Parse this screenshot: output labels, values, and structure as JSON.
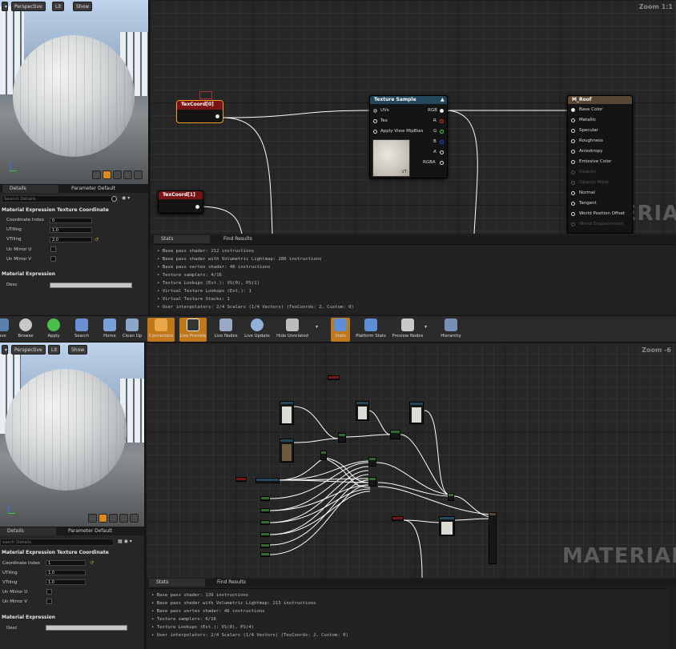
{
  "top": {
    "viewport": {
      "perspective_label": "Perspective",
      "lit_label": "Lit",
      "show_label": "Show"
    },
    "details": {
      "tab_details": "Details",
      "tab_param": "Parameter Default",
      "search_placeholder": "Search Details",
      "section_title": "Material Expression Texture Coordinate",
      "coord_index_label": "Coordinate Index",
      "coord_index_value": "0",
      "utiling_label": "UTiling",
      "utiling_value": "1.0",
      "vtiling_label": "VTiling",
      "vtiling_value": "2.0",
      "unmirror_u_label": "Un Mirror U",
      "unmirror_v_label": "Un Mirror V",
      "section2_title": "Material Expression",
      "desc_label": "Desc"
    },
    "graph": {
      "zoom": "Zoom 1:1",
      "watermark": "MATERIAL",
      "texcoord0": "TexCoord[0]",
      "texcoord1": "TexCoord[1]",
      "texture_sample": {
        "title": "Texture Sample",
        "pins_in": [
          "UVs",
          "Tex",
          "Apply View MipBias"
        ],
        "pins_out": [
          "RGB",
          "R",
          "G",
          "B",
          "A",
          "RGBA"
        ],
        "thumb_label": "VT"
      },
      "m_roof": {
        "title": "M_Roof",
        "pins": [
          "Base Color",
          "Metallic",
          "Specular",
          "Roughness",
          "Anisotropy",
          "Emissive Color",
          "Opacity",
          "Opacity Mask",
          "Normal",
          "Tangent",
          "World Position Offset",
          "World Displacement"
        ]
      }
    },
    "stats": {
      "tab_stats": "Stats",
      "tab_find": "Find Results",
      "lines": [
        "• Base pass shader: 212 instructions",
        "• Base pass shader with Volumetric Lightmap: 286 instructions",
        "• Base pass vertex shader: 46 instructions",
        "• Texture samplers: 4/16",
        "• Texture Lookups (Est.): VS(0), PS(1)",
        "• Virtual Texture Lookups (Est.): 1",
        "• Virtual Texture Stacks: 1",
        "• User interpolators: 2/4 Scalars (1/4 Vectors) (TexCoords: 2, Custom: 0)"
      ]
    }
  },
  "toolbar": {
    "buttons": [
      "ave",
      "Browse",
      "Apply",
      "Search",
      "Home",
      "Clean Up",
      "Connectors",
      "Live Preview",
      "Live Nodes",
      "Live Update",
      "Hide Unrelated",
      "Stats",
      "Platform Stats",
      "Preview Nodes",
      "Hierarchy"
    ]
  },
  "bottom": {
    "viewport": {
      "perspective_label": "Perspective",
      "lit_label": "Lit",
      "show_label": "Show"
    },
    "details": {
      "tab_details": "Details",
      "tab_param": "Parameter Default",
      "search_placeholder": "earch Details",
      "section_title": "Material Expression Texture Coordinate",
      "coord_index_label": "Coordinate Index",
      "coord_index_value": "1",
      "utiling_label": "UTiling",
      "utiling_value": "1.0",
      "vtiling_label": "VTiling",
      "vtiling_value": "1.0",
      "unmirror_u_label": "Un Mirror U",
      "unmirror_v_label": "Un Mirror V",
      "section2_title": "Material Expression",
      "desc_label": "Desc"
    },
    "graph": {
      "zoom": "Zoom -6",
      "watermark": "MATERIAL"
    },
    "stats": {
      "tab_stats": "Stats",
      "tab_find": "Find Results",
      "lines": [
        "• Base pass shader: 139 instructions",
        "• Base pass shader with Volumetric Lightmap: 213 instructions",
        "• Base pass vertex shader: 46 instructions",
        "• Texture samplers: 6/16",
        "• Texture Lookups (Est.): VS(0), PS(4)",
        "• User interpolators: 2/4 Scalars (1/4 Vectors) (TexCoords: 2, Custom: 0)"
      ]
    }
  }
}
